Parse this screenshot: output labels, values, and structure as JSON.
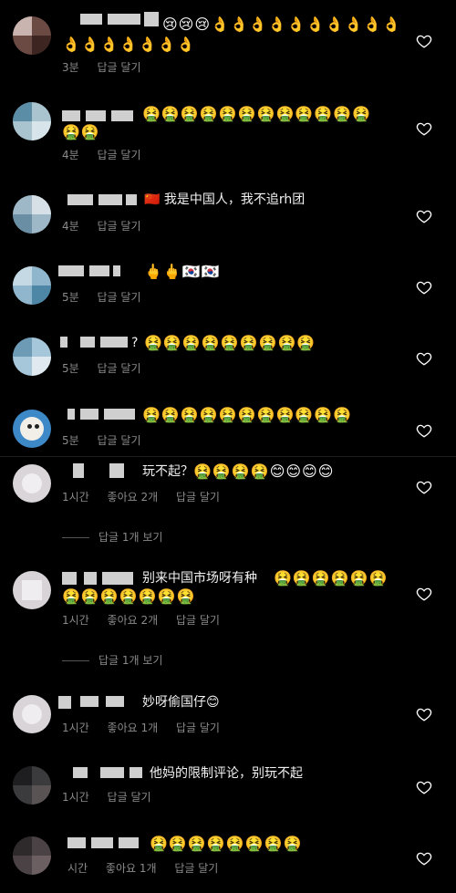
{
  "comments": [
    {
      "text": "",
      "emoji_line1": "😢😢😢👌👌👌👌👌👌👌👌👌👌",
      "emoji_line2": "👌👌👌👌👌👌👌",
      "time": "3분",
      "likes": "",
      "reply": "답글 달기"
    },
    {
      "text": "",
      "emoji_line1": "🤮🤮🤮🤮🤮🤮🤮🤮🤮🤮🤮🤮",
      "emoji_line2": "🤮🤮",
      "time": "4분",
      "likes": "",
      "reply": "답글 달기"
    },
    {
      "text": "我是中国人，我不追rh团",
      "flag": "🇨🇳",
      "time": "4분",
      "likes": "",
      "reply": "답글 달기"
    },
    {
      "text": "",
      "emoji_line1": "🖕🖕🇰🇷🇰🇷",
      "time": "5분",
      "likes": "",
      "reply": "답글 달기"
    },
    {
      "text": "?",
      "emoji_line1": "🤮🤮🤮🤮🤮🤮🤮🤮🤮",
      "time": "5분",
      "likes": "",
      "reply": "답글 달기"
    },
    {
      "text": "",
      "emoji_line1": "🤮🤮🤮🤮🤮🤮🤮🤮🤮🤮🤮",
      "time": "5분",
      "likes": "",
      "reply": "답글 달기"
    },
    {
      "text": "玩不起？",
      "emoji_line1": "🤮🤮🤮🤮😊😊😊😊",
      "time": "1시간",
      "likes": "좋아요 2개",
      "reply": "답글 달기",
      "view_replies": "답글 1개 보기"
    },
    {
      "text": "别来中国市场呀有种",
      "emoji_line1": "🤮🤮🤮🤮🤮🤮",
      "emoji_line2": "🤮🤮🤮🤮🤮🤮🤮",
      "time": "1시간",
      "likes": "좋아요 2개",
      "reply": "답글 달기",
      "view_replies": "답글 1개 보기"
    },
    {
      "text": "妙呀偷国仔",
      "emoji_line1": "😊",
      "time": "1시간",
      "likes": "좋아요 1개",
      "reply": "답글 달기"
    },
    {
      "text": "他妈的限制评论，别玩不起",
      "time": "1시간",
      "likes": "",
      "reply": "답글 달기"
    },
    {
      "text": "",
      "emoji_line1": "🤮🤮🤮🤮🤮🤮🤮🤮",
      "time": "시간",
      "likes": "좋아요 1개",
      "reply": "답글 달기"
    }
  ],
  "icons": {
    "like": "heart-outline-icon"
  },
  "colors": {
    "background": "#000000",
    "meta_text": "#8a8a8a"
  }
}
